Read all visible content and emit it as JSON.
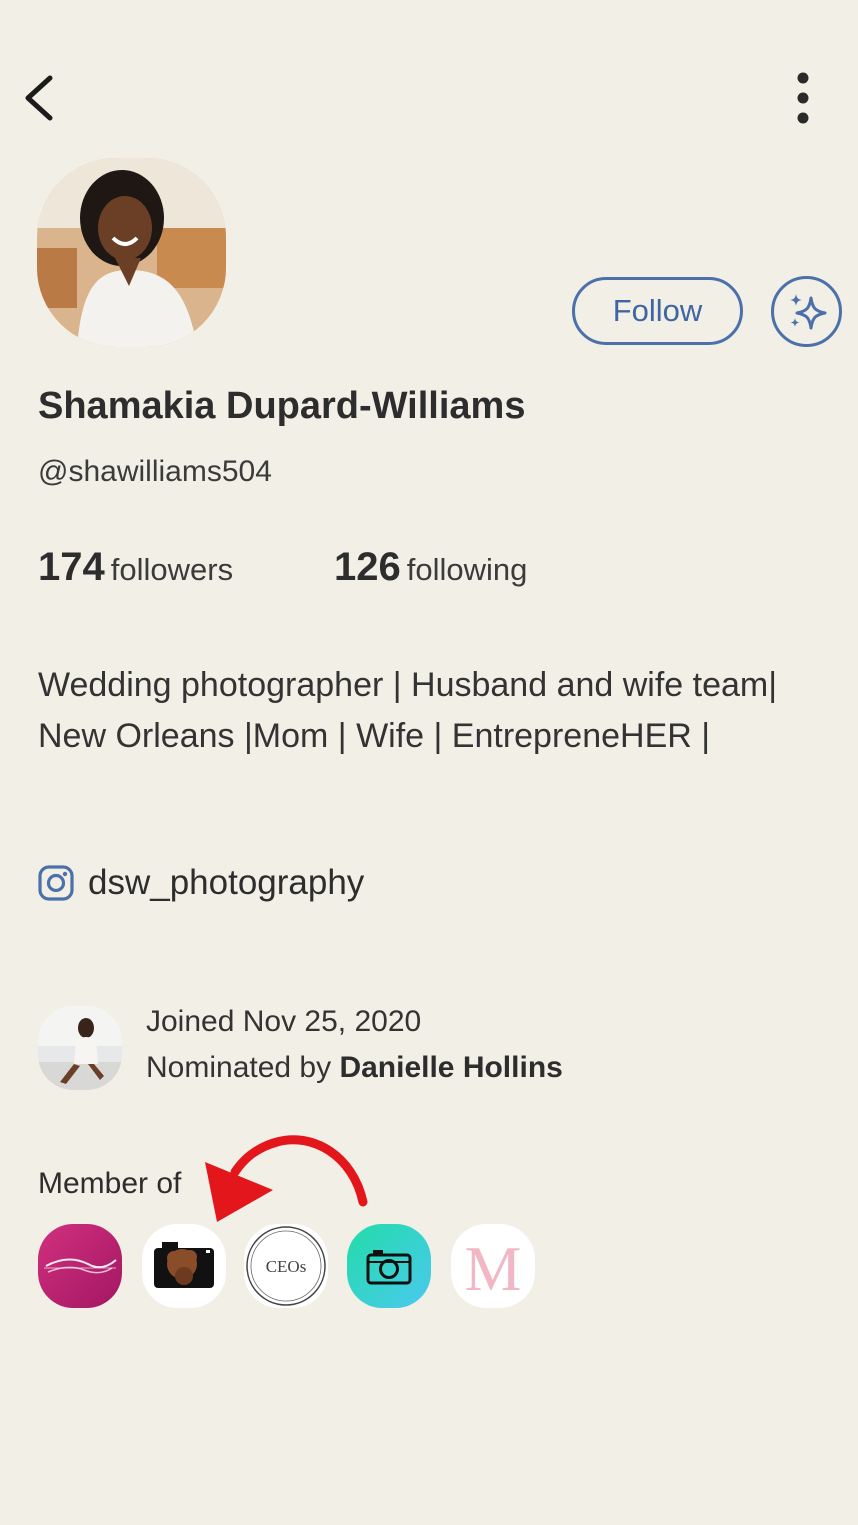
{
  "header": {
    "back_icon": "chevron-left-icon",
    "more_icon": "vertical-ellipsis-icon"
  },
  "profile": {
    "name": "Shamakia Dupard-Williams",
    "handle": "@shawilliams504",
    "follow_label": "Follow",
    "followers_count": "174",
    "followers_label": "followers",
    "following_count": "126",
    "following_label": "following",
    "bio": "Wedding photographer | Husband and wife team| New Orleans |Mom | Wife | EntrepreneHER |",
    "instagram": "dsw_photography"
  },
  "membership": {
    "joined": "Joined Nov 25, 2020",
    "nominated_prefix": "Nominated by ",
    "nominator": "Danielle Hollins",
    "member_of_label": "Member of",
    "club_ceos_text": "CEOs",
    "club_m_text": "M"
  },
  "colors": {
    "background": "#f1efe6",
    "accent_blue": "#4b70aa",
    "annotation_red": "#e3171b"
  }
}
